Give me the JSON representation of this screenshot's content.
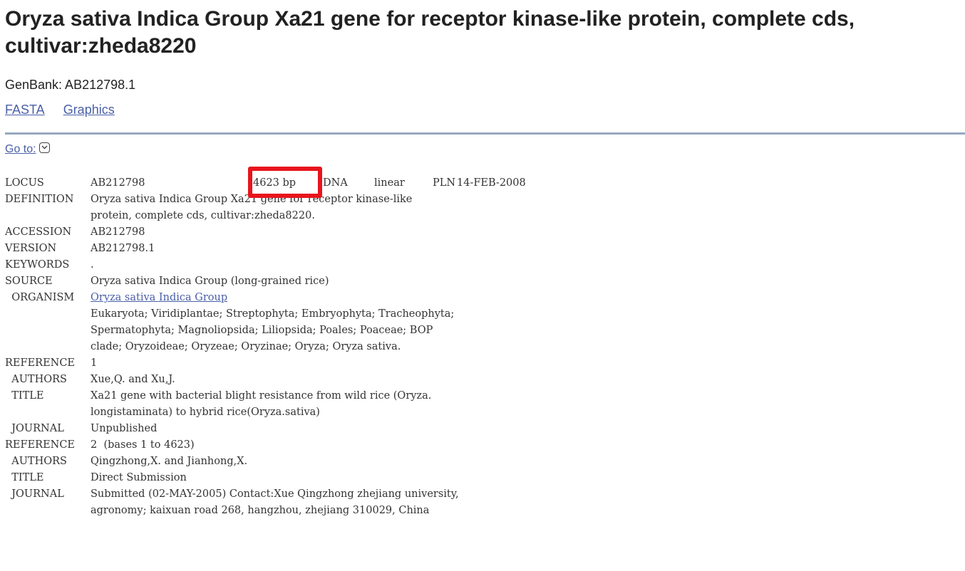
{
  "page": {
    "title": "Oryza sativa Indica Group Xa21 gene for receptor kinase-like protein, complete cds, cultivar:zheda8220",
    "accession_line": "GenBank: AB212798.1",
    "links": [
      "FASTA",
      "Graphics"
    ],
    "goto_label": "Go to:"
  },
  "locus": {
    "key": "LOCUS",
    "name": "AB212798",
    "length": "4623 bp",
    "molecule": "DNA",
    "topology": "linear",
    "division": "PLN",
    "date": "14-FEB-2008"
  },
  "record": [
    {
      "key": "DEFINITION",
      "value": "Oryza sativa Indica Group Xa21 gene for receptor kinase-like"
    },
    {
      "key": "",
      "value": "protein, complete cds, cultivar:zheda8220."
    },
    {
      "key": "ACCESSION",
      "value": "AB212798"
    },
    {
      "key": "VERSION",
      "value": "AB212798.1"
    },
    {
      "key": "KEYWORDS",
      "value": "."
    },
    {
      "key": "SOURCE",
      "value": "Oryza sativa Indica Group (long-grained rice)"
    },
    {
      "key": "  ORGANISM",
      "value": "Oryza sativa Indica Group",
      "link": true
    },
    {
      "key": "",
      "value": "Eukaryota; Viridiplantae; Streptophyta; Embryophyta; Tracheophyta;"
    },
    {
      "key": "",
      "value": "Spermatophyta; Magnoliopsida; Liliopsida; Poales; Poaceae; BOP"
    },
    {
      "key": "",
      "value": "clade; Oryzoideae; Oryzeae; Oryzinae; Oryza; Oryza sativa."
    },
    {
      "key": "REFERENCE",
      "value": "1"
    },
    {
      "key": "  AUTHORS",
      "value": "Xue,Q. and Xu,J."
    },
    {
      "key": "  TITLE",
      "value": "Xa21 gene with bacterial blight resistance from wild rice (Oryza."
    },
    {
      "key": "",
      "value": "longistaminata) to hybrid rice(Oryza.sativa)"
    },
    {
      "key": "  JOURNAL",
      "value": "Unpublished"
    },
    {
      "key": "REFERENCE",
      "value": "2  (bases 1 to 4623)"
    },
    {
      "key": "  AUTHORS",
      "value": "Qingzhong,X. and Jianhong,X."
    },
    {
      "key": "  TITLE",
      "value": "Direct Submission"
    },
    {
      "key": "  JOURNAL",
      "value": "Submitted (02-MAY-2005) Contact:Xue Qingzhong zhejiang university,"
    },
    {
      "key": "",
      "value": "agronomy; kaixuan road 268, hangzhou, zhejiang 310029, China"
    }
  ],
  "colors": {
    "link": "#4a5fa8",
    "divider": "#97a8bf",
    "highlight": "#e8141c"
  }
}
